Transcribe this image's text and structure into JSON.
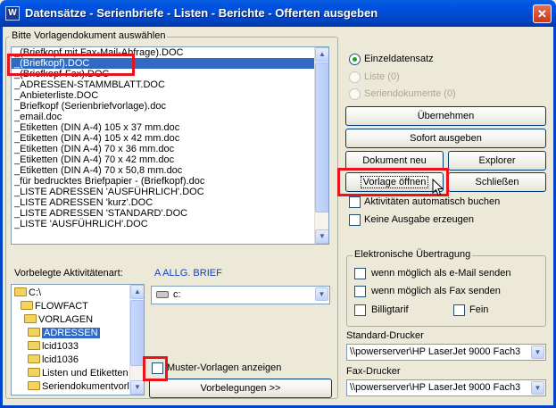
{
  "window": {
    "title": "Datensätze - Serienbriefe - Listen - Berichte - Offerten ausgeben",
    "icon_letter": "W"
  },
  "template_group": {
    "label": "Bitte Vorlagendokument auswählen",
    "items": [
      "_(Briefkopf mit Fax-Mail-Abfrage).DOC",
      "_(Briefkopf).DOC",
      "_(Briefkopf-Fax).DOC",
      "_ADRESSEN-STAMMBLATT.DOC",
      "_Anbieterliste.DOC",
      "_Briefkopf (Serienbriefvorlage).doc",
      "_email.doc",
      "_Etiketten (DIN A-4) 105 x 37 mm.doc",
      "_Etiketten (DIN A-4) 105 x 42 mm.doc",
      "_Etiketten (DIN A-4) 70 x 36 mm.doc",
      "_Etiketten (DIN A-4) 70 x 42 mm.doc",
      "_Etiketten (DIN A-4) 70 x 50,8 mm.doc",
      "_für bedrucktes Briefpapier - (Briefkopf).doc",
      "_LISTE ADRESSEN 'AUSFÜHRLICH'.DOC",
      "_LISTE ADRESSEN 'kurz'.DOC",
      "_LISTE ADRESSEN 'STANDARD'.DOC",
      "_LISTE 'AUSFÜHRLICH'.DOC"
    ],
    "selected_index": 1,
    "activity_label": "Vorbelegte Aktivitätenart:",
    "activity_value": "A ALLG. BRIEF"
  },
  "tree": {
    "items": [
      "C:\\",
      "FLOWFACT",
      "VORLAGEN",
      "ADRESSEN",
      "lcid1033",
      "lcid1036",
      "Listen und Etiketten",
      "Seriendokumentvorla"
    ],
    "selected_index": 3
  },
  "drive_combo": {
    "value": "c:"
  },
  "muster_checkbox": {
    "label": "Muster-Vorlagen anzeigen",
    "checked": false
  },
  "vorbelegungen_button": "Vorbelegungen >>",
  "output_mode": {
    "options": [
      {
        "label": "Einzeldatensatz",
        "checked": true,
        "disabled": false
      },
      {
        "label": "Liste (0)",
        "checked": false,
        "disabled": true
      },
      {
        "label": "Seriendokumente (0)",
        "checked": false,
        "disabled": true
      }
    ]
  },
  "buttons": {
    "uebernehmen": "Übernehmen",
    "sofort": "Sofort ausgeben",
    "dokument_neu": "Dokument neu",
    "explorer": "Explorer",
    "vorlage_oeffnen": "Vorlage öffnen",
    "schliessen": "Schließen"
  },
  "options": {
    "aktivitaeten": "Aktivitäten automatisch buchen",
    "keine_ausgabe": "Keine Ausgabe erzeugen"
  },
  "electronic": {
    "label": "Elektronische Übertragung",
    "email": "wenn möglich als e-Mail senden",
    "fax": "wenn möglich als Fax senden",
    "billigtarif": "Billigtarif",
    "fein": "Fein"
  },
  "printers": {
    "standard_label": "Standard-Drucker",
    "standard_value": "\\\\powerserver\\HP LaserJet 9000 Fach3",
    "fax_label": "Fax-Drucker",
    "fax_value": "\\\\powerserver\\HP LaserJet 9000 Fach3"
  },
  "colors": {
    "highlight": "#e8131c",
    "selection": "#316ac5",
    "accent_text": "#1040c0"
  },
  "icons": {
    "drive": "drive-icon",
    "folder": "folder-icon",
    "cursor": "mouse-cursor-icon"
  }
}
